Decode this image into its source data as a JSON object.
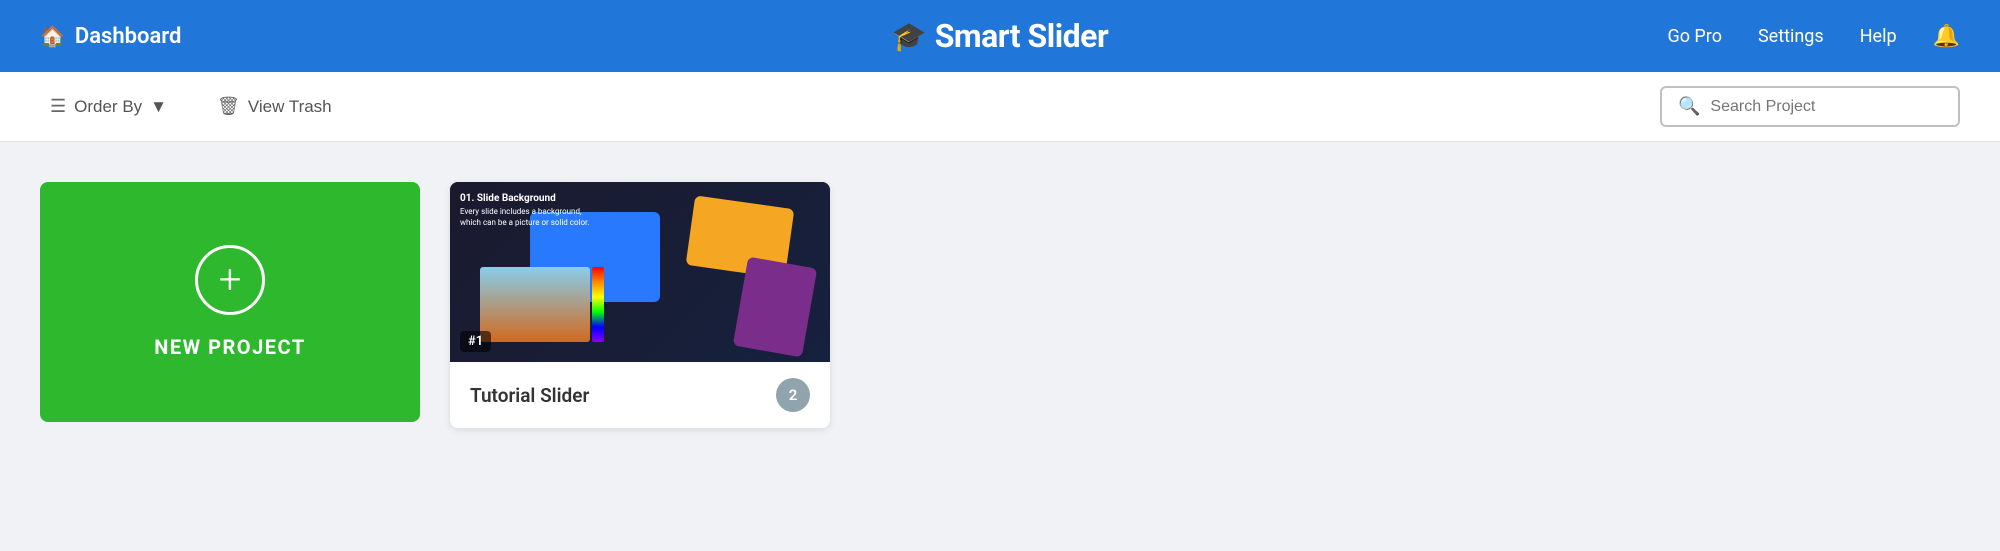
{
  "header": {
    "dashboard_label": "Dashboard",
    "logo_text": "Smart Slider",
    "go_pro_label": "Go Pro",
    "settings_label": "Settings",
    "help_label": "Help"
  },
  "toolbar": {
    "order_by_label": "Order By",
    "view_trash_label": "View Trash",
    "search_placeholder": "Search Project"
  },
  "new_project": {
    "label": "NEW PROJECT"
  },
  "projects": [
    {
      "id": 1,
      "title": "Tutorial Slider",
      "slide_count": 2,
      "badge": "#1"
    }
  ]
}
